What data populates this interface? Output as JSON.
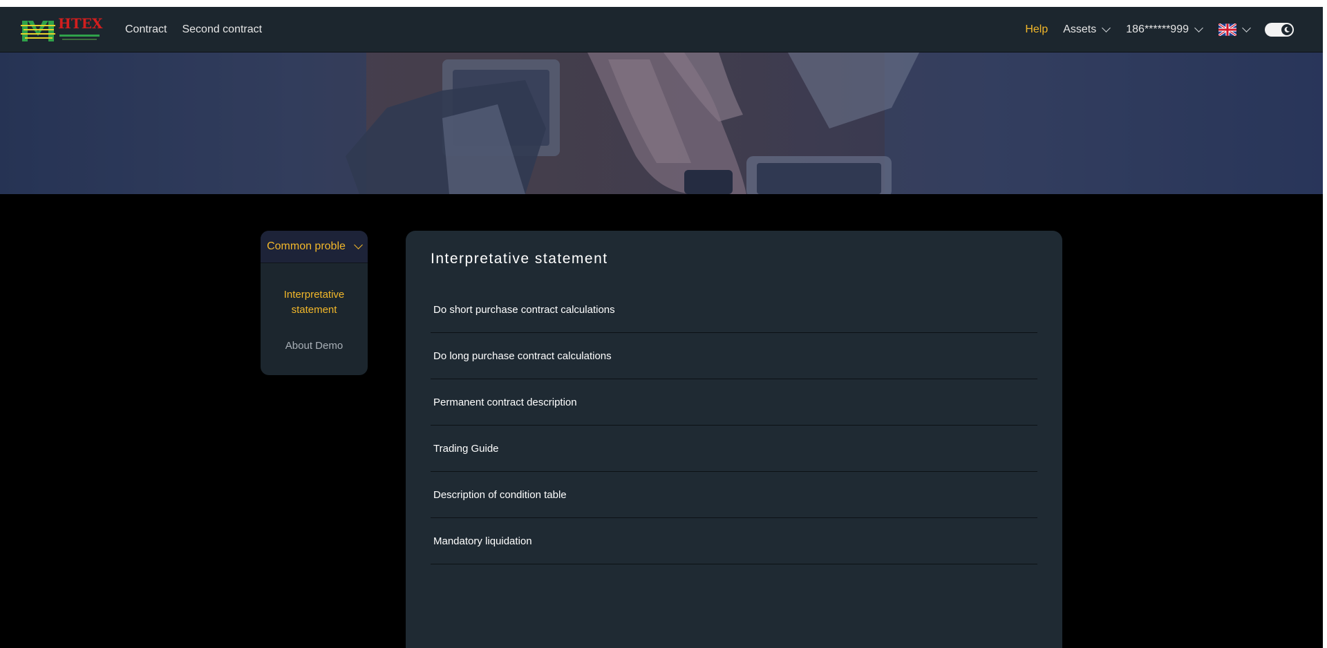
{
  "header": {
    "logo_text": "HTEX",
    "nav": [
      "Contract",
      "Second contract"
    ],
    "help": "Help",
    "assets": "Assets",
    "account": "186******999",
    "language_icon": "uk-flag-icon",
    "theme_toggle_icon": "moon-icon"
  },
  "sidebar": {
    "category": "Common proble",
    "items": [
      "Interpretative statement",
      "About Demo"
    ],
    "active_index": 0
  },
  "main": {
    "title": "Interpretative statement",
    "items": [
      "Do short purchase contract calculations",
      "Do long purchase contract calculations",
      "Permanent contract description",
      "Trading Guide",
      "Description of condition table",
      "Mandatory liquidation"
    ]
  },
  "colors": {
    "accent": "#f3b82a",
    "header_bg": "#1c262e",
    "card_bg": "#1f2a33",
    "page_bg": "#000000"
  }
}
